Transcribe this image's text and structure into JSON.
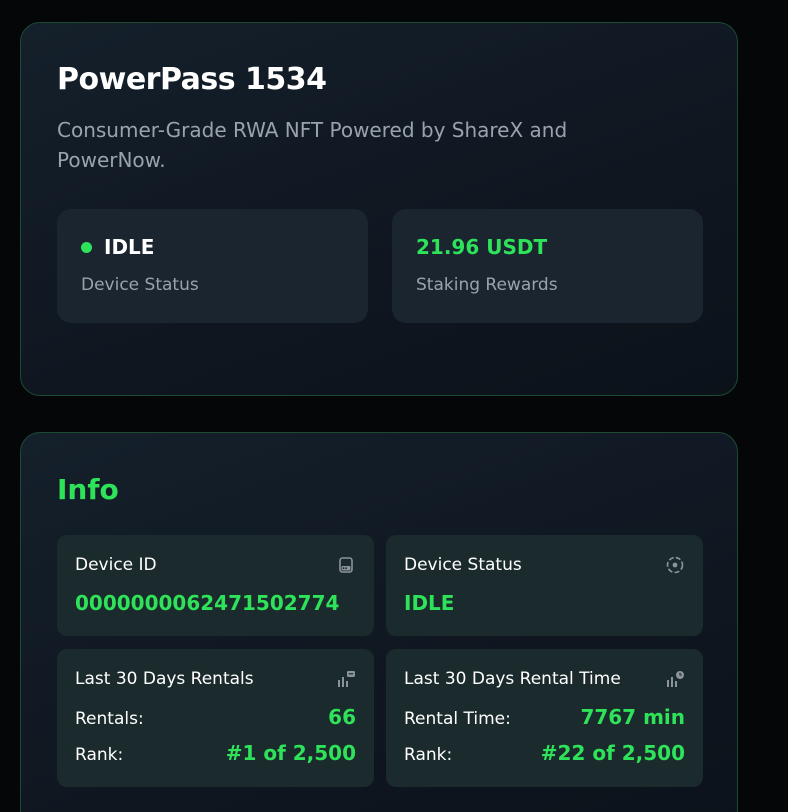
{
  "colors": {
    "accent": "#2ee35a",
    "background": "#050607",
    "card_border": "#1c4a33",
    "muted_text": "#9aa3ad"
  },
  "header": {
    "title": "PowerPass 1534",
    "subtitle": "Consumer-Grade RWA NFT Powered by ShareX and PowerNow."
  },
  "summary": {
    "status": {
      "value": "IDLE",
      "label": "Device Status",
      "indicator_color": "#2ee35a"
    },
    "rewards": {
      "value": "21.96 USDT",
      "label": "Staking Rewards"
    }
  },
  "info": {
    "title": "Info",
    "device_id": {
      "label": "Device ID",
      "value": "0000000062471502774",
      "icon": "device-icon"
    },
    "device_status": {
      "label": "Device Status",
      "value": "IDLE",
      "icon": "status-icon"
    },
    "rentals": {
      "label": "Last 30 Days Rentals",
      "icon": "rentals-chart-icon",
      "rows": [
        {
          "key": "Rentals:",
          "value": "66"
        },
        {
          "key": "Rank:",
          "value": "#1 of 2,500"
        }
      ]
    },
    "rental_time": {
      "label": "Last 30 Days Rental Time",
      "icon": "rental-time-chart-icon",
      "rows": [
        {
          "key": "Rental Time:",
          "value": "7767 min"
        },
        {
          "key": "Rank:",
          "value": "#22 of 2,500"
        }
      ]
    }
  }
}
